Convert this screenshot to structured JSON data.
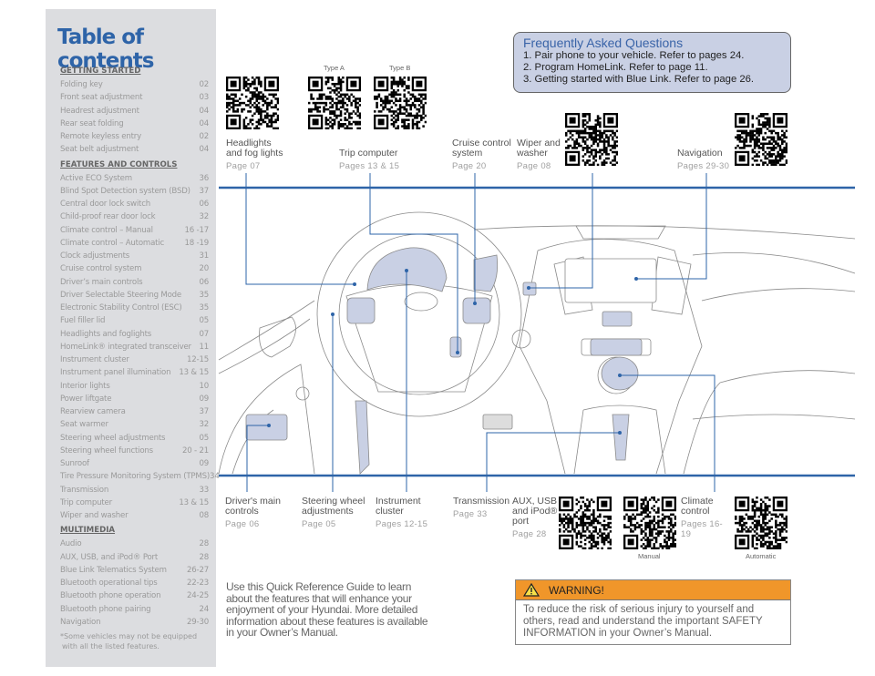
{
  "toc": {
    "title": "Table of contents",
    "sections": [
      {
        "heading": "GETTING STARTED",
        "items": [
          {
            "label": "Folding key",
            "page": "02"
          },
          {
            "label": "Front seat adjustment",
            "page": "03"
          },
          {
            "label": "Headrest adjustment",
            "page": "04"
          },
          {
            "label": "Rear seat folding",
            "page": "04"
          },
          {
            "label": "Remote keyless entry",
            "page": "02"
          },
          {
            "label": "Seat belt adjustment",
            "page": "04"
          }
        ]
      },
      {
        "heading": "FEATURES AND CONTROLS",
        "items": [
          {
            "label": "Active ECO System",
            "page": "36"
          },
          {
            "label": "Blind Spot Detection system (BSD)",
            "page": "37"
          },
          {
            "label": "Central door lock switch",
            "page": "06"
          },
          {
            "label": "Child-proof rear door lock",
            "page": "32"
          },
          {
            "label": "Climate control – Manual",
            "page": "16 -17"
          },
          {
            "label": "Climate control – Automatic",
            "page": "18 -19"
          },
          {
            "label": "Clock adjustments",
            "page": "31"
          },
          {
            "label": "Cruise control system",
            "page": "20"
          },
          {
            "label": "Driver’s main controls",
            "page": "06"
          },
          {
            "label": "Driver Selectable Steering Mode",
            "page": "35"
          },
          {
            "label": "Electronic Stability Control (ESC)",
            "page": "35"
          },
          {
            "label": "Fuel filler lid",
            "page": "05"
          },
          {
            "label": "Headlights and foglights",
            "page": "07"
          },
          {
            "label": "HomeLink® integrated transceiver",
            "page": "11"
          },
          {
            "label": "Instrument cluster",
            "page": "12-15"
          },
          {
            "label": "Instrument panel illumination",
            "page": "13 & 15"
          },
          {
            "label": "Interior lights",
            "page": "10"
          },
          {
            "label": "Power liftgate",
            "page": "09"
          },
          {
            "label": "Rearview camera",
            "page": "37"
          },
          {
            "label": "Seat warmer",
            "page": "32"
          },
          {
            "label": "Steering wheel adjustments",
            "page": "05"
          },
          {
            "label": "Steering wheel functions",
            "page": "20 - 21"
          },
          {
            "label": "Sunroof",
            "page": "09"
          },
          {
            "label": "Tire Pressure Monitoring System (TPMS)",
            "page": "34"
          },
          {
            "label": "Transmission",
            "page": "33"
          },
          {
            "label": "Trip computer",
            "page": "13 & 15"
          },
          {
            "label": "Wiper and washer",
            "page": "08"
          }
        ]
      },
      {
        "heading": "MULTIMEDIA",
        "items": [
          {
            "label": "Audio",
            "page": "28"
          },
          {
            "label": "AUX, USB, and iPod® Port",
            "page": "28"
          },
          {
            "label": "Blue Link Telematics System",
            "page": "26-27"
          },
          {
            "label": "Bluetooth operational tips",
            "page": "22-23"
          },
          {
            "label": "Bluetooth phone operation",
            "page": "24-25"
          },
          {
            "label": "Bluetooth phone pairing",
            "page": "24"
          },
          {
            "label": "Navigation",
            "page": "29-30"
          }
        ]
      }
    ],
    "footnote": "*Some vehicles may not be equipped with all the listed features."
  },
  "faq": {
    "title": "Frequently Asked Questions",
    "items": [
      "1. Pair phone to your vehicle. Refer to pages 24.",
      "2. Program HomeLink. Refer to page 11.",
      "3. Getting started with Blue Link. Refer to page 26."
    ]
  },
  "qr_captions": {
    "type_a": "Type A",
    "type_b": "Type B",
    "manual": "Manual",
    "automatic": "Automatic"
  },
  "callouts": {
    "headlights": {
      "title": "Headlights and fog lights",
      "page": "Page 07"
    },
    "trip": {
      "title": "Trip computer",
      "page": "Pages 13 & 15"
    },
    "cruise": {
      "title": "Cruise control system",
      "page": "Page 20"
    },
    "wiper": {
      "title": "Wiper and washer",
      "page": "Page 08"
    },
    "navigation": {
      "title": "Navigation",
      "page": "Pages 29-30"
    },
    "drivers": {
      "title": "Driver's main controls",
      "page": "Page 06"
    },
    "steering": {
      "title": "Steering wheel adjustments",
      "page": "Page 05"
    },
    "cluster": {
      "title": "Instrument cluster",
      "page": "Pages 12-15"
    },
    "transmission": {
      "title": "Transmission",
      "page": "Page 33"
    },
    "aux": {
      "title": "AUX, USB and iPod® port",
      "page": "Page 28"
    },
    "climate": {
      "title": "Climate control",
      "page": "Pages 16-19"
    }
  },
  "intro": "Use this Quick Reference Guide to learn about the features that will enhance your enjoyment of your Hyundai. More detailed information about these features is available in your Owner’s Manual.",
  "warning": {
    "icon": "warning-triangle-icon",
    "title": "WARNING!",
    "body": "To reduce the risk of serious injury to yourself and others, read and understand the important SAFETY INFORMATION in your Owner’s Manual."
  },
  "colors": {
    "accent": "#2e64a8",
    "highlight": "#c9d0e4",
    "warning": "#f0962a",
    "panel": "#dcdde0"
  }
}
